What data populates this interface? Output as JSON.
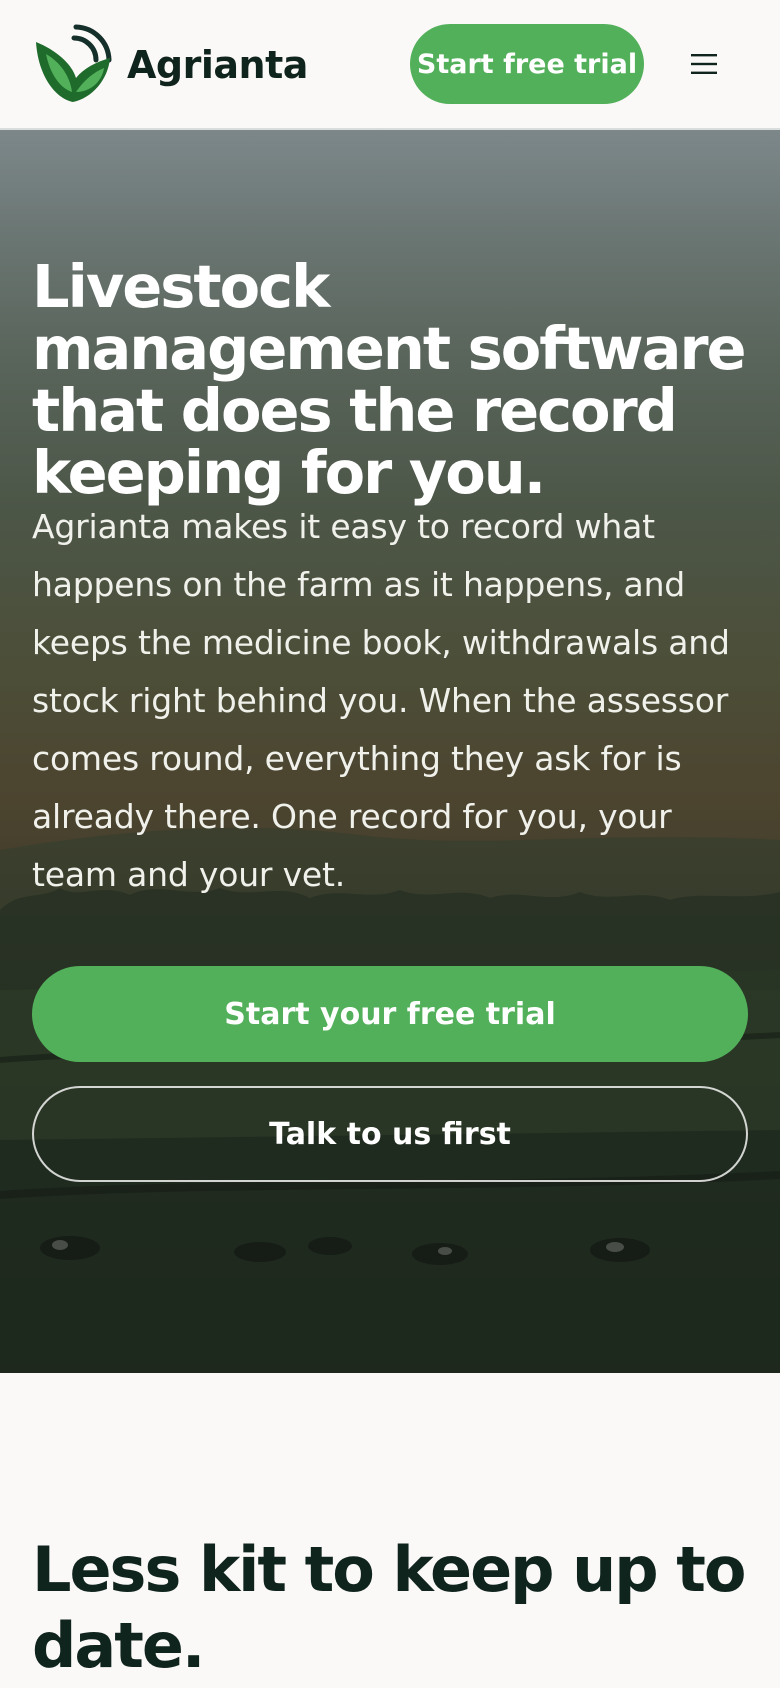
{
  "header": {
    "brand": "Agrianta",
    "logo_icon": "leaf-signal-logo",
    "trial_button": "Start free trial",
    "menu_icon": "hamburger-menu-icon"
  },
  "hero": {
    "title": "Livestock management software that does the record keeping for you.",
    "body": "Agrianta makes it easy to record what happens on the farm as it happens, and keeps the medicine book, withdrawals and stock right behind you. When the assessor comes round, everything they ask for is already there. One record for you, your team and your vet.",
    "primary_cta": "Start your free trial",
    "secondary_cta": "Talk to us first"
  },
  "features": {
    "title": "Less kit to keep up to date."
  },
  "colors": {
    "brand_green": "#52b05a",
    "dark_text": "#10241e",
    "logo_dark_green": "#1f6b2c",
    "page_background": "#fbf9f8"
  }
}
